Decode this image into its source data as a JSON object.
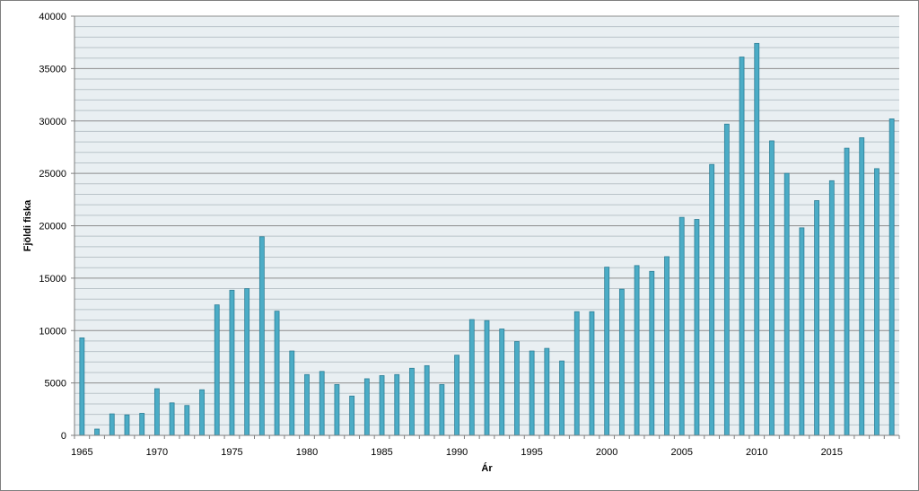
{
  "chart_data": {
    "type": "bar",
    "title": "",
    "xlabel": "Ár",
    "ylabel": "Fjöldi fiska",
    "ylim": [
      0,
      40000
    ],
    "y_ticks": [
      0,
      5000,
      10000,
      15000,
      20000,
      25000,
      30000,
      35000,
      40000
    ],
    "x_tick_labels": [
      "1965",
      "1970",
      "1975",
      "1980",
      "1985",
      "1990",
      "1995",
      "2000",
      "2005",
      "2010",
      "2015"
    ],
    "grid": "horizontal, major and minor",
    "legend": "none",
    "colors": {
      "bar_fill": "#4bacc6",
      "bar_stroke": "#2e7f96",
      "plot_bg": "#e9eff2",
      "major_grid": "#8c8c8c",
      "minor_grid": "#b9c3c8"
    },
    "categories": [
      1965,
      1966,
      1967,
      1968,
      1969,
      1970,
      1971,
      1972,
      1973,
      1974,
      1975,
      1976,
      1977,
      1978,
      1979,
      1980,
      1981,
      1982,
      1983,
      1984,
      1985,
      1986,
      1987,
      1988,
      1989,
      1990,
      1991,
      1992,
      1993,
      1994,
      1995,
      1996,
      1997,
      1998,
      1999,
      2000,
      2001,
      2002,
      2003,
      2004,
      2005,
      2006,
      2007,
      2008,
      2009,
      2010,
      2011,
      2012,
      2013,
      2014,
      2015,
      2016,
      2017,
      2018,
      2019
    ],
    "values": [
      9300,
      600,
      2050,
      1950,
      2100,
      4450,
      3100,
      2850,
      4350,
      12450,
      13850,
      14000,
      18950,
      11850,
      8050,
      5800,
      6100,
      4850,
      3750,
      5400,
      5700,
      5800,
      6400,
      6650,
      4850,
      7650,
      11050,
      10950,
      10150,
      8950,
      8050,
      8300,
      7100,
      11800,
      11800,
      16050,
      13950,
      16200,
      15650,
      17050,
      20800,
      20600,
      25850,
      29700,
      36100,
      37400,
      28100,
      25000,
      19800,
      22400,
      24300,
      27400,
      28400,
      25450,
      30200
    ]
  }
}
